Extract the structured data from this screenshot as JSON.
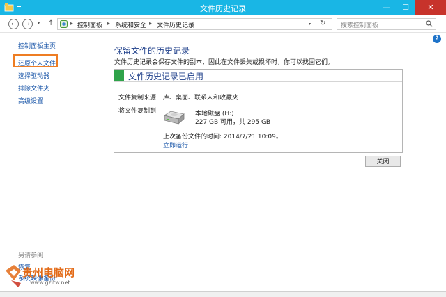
{
  "window": {
    "title": "文件历史记录",
    "min": "—",
    "max": "☐",
    "close": "✕"
  },
  "toolbar": {
    "back": "←",
    "forward": "→",
    "history_dd": "▾",
    "up": "↑",
    "breadcrumbs": [
      "控制面板",
      "系统和安全",
      "文件历史记录"
    ],
    "separator": "▸",
    "address_dd": "▾",
    "refresh": "↻",
    "search_placeholder": "搜索控制面板"
  },
  "sidebar": {
    "items": [
      "控制面板主页",
      "还原个人文件",
      "选择驱动器",
      "排除文件夹",
      "高级设置"
    ],
    "highlighted": "还原个人文件",
    "see_also_heading": "另请参阅",
    "see_also_items": [
      "恢复",
      "系统映像备份"
    ]
  },
  "main": {
    "title": "保留文件的历史记录",
    "description": "文件历史记录会保存文件的副本，因此在文件丢失或损坏时，你可以找回它们。",
    "panel": {
      "status": "文件历史记录已启用",
      "source_label": "文件复制来源:",
      "source_value": "库、桌面、联系人和收藏夹",
      "dest_label": "将文件复制到:",
      "drive_name": "本地磁盘 (H:)",
      "drive_space": "227 GB 可用，共 295 GB",
      "last_backup": "上次备份文件的时间: 2014/7/21 10:09。",
      "run_now": "立即运行"
    },
    "close_button": "关闭",
    "help": "?"
  },
  "watermark": {
    "text": "贵州电脑网",
    "url": "www.gzitw.net"
  },
  "colors": {
    "title_bar": "#19b6e5",
    "close_red": "#c7332b",
    "link_blue": "#1a56a8",
    "heading_blue": "#1e3f8a",
    "status_green": "#2fa34a",
    "highlight_orange": "#ee7d23"
  }
}
